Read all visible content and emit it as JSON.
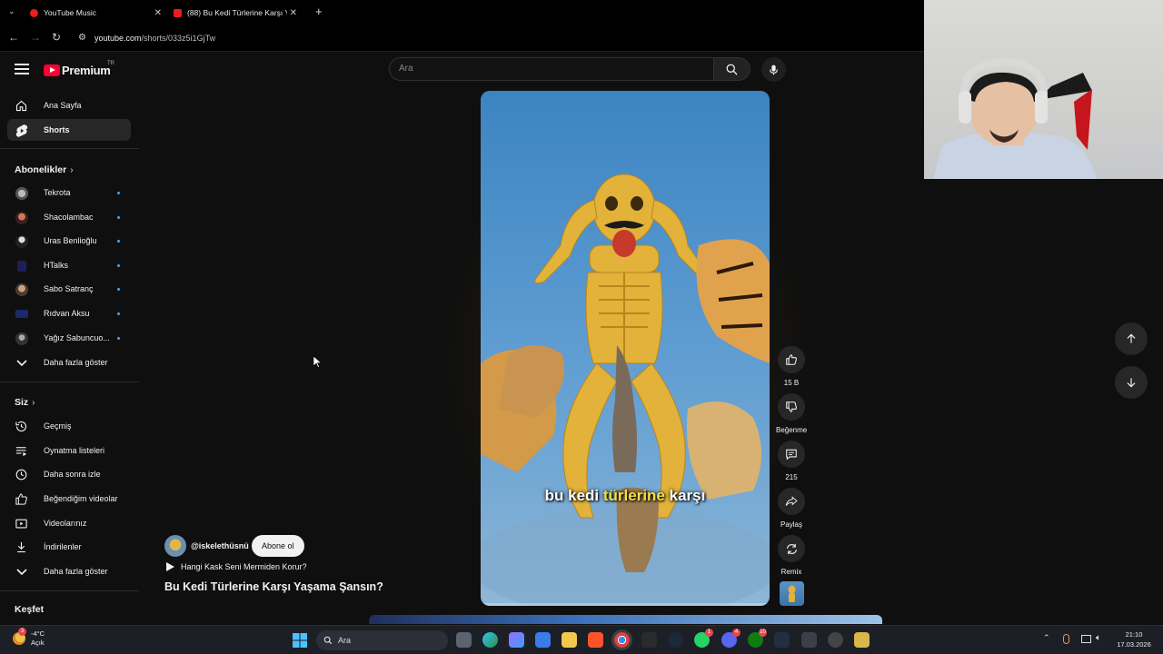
{
  "browser": {
    "tabs": [
      {
        "title": "YouTube Music"
      },
      {
        "title": "(88) Bu Kedi Türlerine Karşı Yaşa..."
      }
    ],
    "url_host": "youtube.com",
    "url_path": "/shorts/033z5i1GjTw"
  },
  "header": {
    "logo_text": "Premium",
    "region": "TR",
    "search_placeholder": "Ara"
  },
  "sidebar": {
    "main": [
      {
        "label": "Ana Sayfa",
        "icon": "home-icon"
      },
      {
        "label": "Shorts",
        "icon": "shorts-icon",
        "active": true
      }
    ],
    "subscriptions_title": "Abonelikler",
    "subscriptions": [
      {
        "label": "Tekrota"
      },
      {
        "label": "Shacolambac"
      },
      {
        "label": "Uras Benlioğlu"
      },
      {
        "label": "HTalks"
      },
      {
        "label": "Sabo Satranç"
      },
      {
        "label": "Rıdvan Aksu"
      },
      {
        "label": "Yağız Sabuncuo..."
      }
    ],
    "show_more": "Daha fazla göster",
    "you_title": "Siz",
    "you": [
      {
        "label": "Geçmiş",
        "icon": "history-icon"
      },
      {
        "label": "Oynatma listeleri",
        "icon": "playlists-icon"
      },
      {
        "label": "Daha sonra izle",
        "icon": "watch-later-icon"
      },
      {
        "label": "Beğendiğim videolar",
        "icon": "liked-icon"
      },
      {
        "label": "Videolarınız",
        "icon": "your-videos-icon"
      },
      {
        "label": "İndirilenler",
        "icon": "downloads-icon"
      }
    ],
    "show_more_2": "Daha fazla göster",
    "explore_title": "Keşfet"
  },
  "short": {
    "caption_a": "bu kedi ",
    "caption_hl": "türlerine",
    "caption_b": " karşı",
    "channel": "@iskelethüsnü",
    "subscribe": "Abone ol",
    "linked_video": "Hangi Kask Seni Mermiden Korur?",
    "title": "Bu Kedi Türlerine Karşı Yaşama Şansın?"
  },
  "actions": {
    "likes": "15 B",
    "dislike": "Beğenme",
    "comments": "215",
    "share": "Paylaş",
    "remix": "Remix"
  },
  "taskbar": {
    "temp": "-4°C",
    "weather": "Açık",
    "weather_badge": "3",
    "search": "Ara",
    "time": "21:10",
    "date": "17.03.2026",
    "badges": {
      "whatsapp": "1",
      "discord": "4",
      "xbox": "10"
    }
  },
  "colors": {
    "accent": "#ff0033",
    "subscribe_bg": "#f1f1f1",
    "caption_highlight": "#f4e042"
  }
}
